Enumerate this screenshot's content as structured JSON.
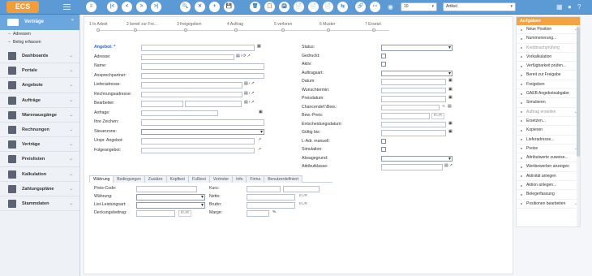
{
  "app": {
    "logo": "ECS"
  },
  "toolbar": {
    "nav": [
      "|<",
      "<",
      ">",
      ">|"
    ],
    "actions": [
      "🔍",
      "✕",
      "+",
      "💾",
      "🗑",
      "📋",
      "🖨",
      "📄",
      "📄",
      "📄",
      "⇆",
      "🔗",
      "⋯"
    ],
    "count_select": "10",
    "type_select": "Artikel"
  },
  "sidebar": {
    "active": "Verträge",
    "subitems": [
      "Adressen",
      "Belog erfassen"
    ],
    "items": [
      {
        "label": "Dashboards",
        "icon": "dashboard-icon"
      },
      {
        "label": "Portale",
        "icon": "portal-icon"
      },
      {
        "label": "Angebote",
        "icon": "offer-icon"
      },
      {
        "label": "Aufträge",
        "icon": "order-icon"
      },
      {
        "label": "Warenausgänge",
        "icon": "goods-out-icon"
      },
      {
        "label": "Rechnungen",
        "icon": "invoice-icon"
      },
      {
        "label": "Verträge",
        "icon": "contract-icon"
      },
      {
        "label": "Preislisten",
        "icon": "pricelist-icon"
      },
      {
        "label": "Kalkulation",
        "icon": "calculation-icon"
      },
      {
        "label": "Zahlungspläne",
        "icon": "payment-plan-icon"
      },
      {
        "label": "Stammdaten",
        "icon": "master-data-icon"
      }
    ]
  },
  "steps": [
    "1 In Arbeit",
    "2 bereit zur Fre...",
    "3 freigegeben",
    "4 Auftrag",
    "5 verloren",
    "6 Muster",
    "7 Ersetzt"
  ],
  "form_left": {
    "fields": [
      "Angebot: *",
      "Adresse:",
      "Name:",
      "Ansprechpartner:",
      "Lieferadresse:",
      "Rechnungsadresse:",
      "Bearbeiter:",
      "Anfrage:",
      "Ihre Zeichen:",
      "Steuerzone:",
      "Urspr. Angebot:",
      "Folgeangebot:"
    ]
  },
  "form_right": {
    "fields": [
      "Status:",
      "Gedruckt:",
      "Aktiv:",
      "Auftragsart:",
      "Datum:",
      "Wunschtermin:",
      "Preisdatum:",
      "Chancendef.\\Bew.:",
      "Bew.-Preis:",
      "Entscheidungsdatum:",
      "Gültig bis:",
      "L-Adr. manuell:",
      "Simulation:",
      "Absagegrund:",
      "Attributklasse:"
    ],
    "percent": "%",
    "currency": "EUR"
  },
  "tabs": [
    "Währung",
    "Bedingungen",
    "Zusätze",
    "Kopftext",
    "Fußtext",
    "Vertreter",
    "Info",
    "Firma",
    "Benutzerdefiniert"
  ],
  "currency_tab": {
    "left_labels": [
      "Preis-Code:",
      "Währung:",
      "List-Leistungsart:",
      "Deckungsbeitrag:"
    ],
    "right_labels": [
      "Kurs:",
      "Netto:",
      "Brutto:",
      "Marge:"
    ],
    "eur": "EUR",
    "pct": "%"
  },
  "tasks": {
    "title": "Aufgaben",
    "items": [
      {
        "label": "Neue Position",
        "more": true,
        "grey": false
      },
      {
        "label": "Nummerierung...",
        "more": false,
        "grey": false
      },
      {
        "label": "Kreditnachprüfung",
        "more": false,
        "grey": true
      },
      {
        "label": "Vorkalkulation",
        "more": false,
        "grey": false
      },
      {
        "label": "Verfügbarkeit prüfen...",
        "more": false,
        "grey": false
      },
      {
        "label": "Bereit zur Freigabe",
        "more": false,
        "grey": false
      },
      {
        "label": "Freigeben",
        "more": false,
        "grey": false
      },
      {
        "label": "GAEB Angebotsabgabe",
        "more": false,
        "grey": false
      },
      {
        "label": "Simulieren",
        "more": false,
        "grey": false
      },
      {
        "label": "Auftrag erstellen",
        "more": true,
        "grey": true
      },
      {
        "label": "Ersetzen...",
        "more": false,
        "grey": false
      },
      {
        "label": "Kopieren",
        "more": false,
        "grey": false
      },
      {
        "label": "Lieferadresse...",
        "more": false,
        "grey": false
      },
      {
        "label": "Preise",
        "more": true,
        "grey": false
      },
      {
        "label": "Attributwerte zuweise...",
        "more": false,
        "grey": false
      },
      {
        "label": "Wertbewerber anzeigen",
        "more": false,
        "grey": false
      },
      {
        "label": "Aktivität anlegen",
        "more": false,
        "grey": false
      },
      {
        "label": "Aktion anlegen...",
        "more": false,
        "grey": false
      },
      {
        "label": "Belegerfassung",
        "more": false,
        "grey": false
      },
      {
        "label": "Positionen bearbeiten",
        "more": true,
        "grey": false
      }
    ]
  }
}
